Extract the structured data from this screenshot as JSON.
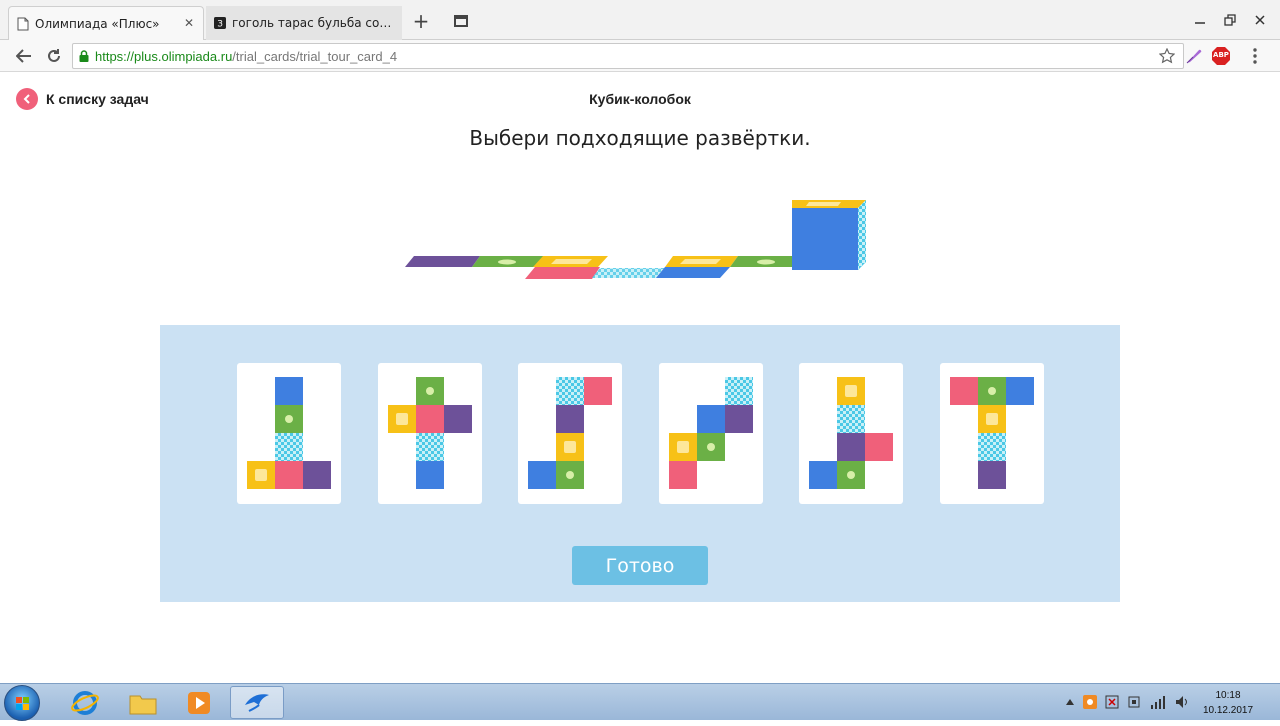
{
  "browser": {
    "tabs": [
      {
        "title": "Олимпиада «Плюс»",
        "active": true,
        "icon": "page-icon"
      },
      {
        "title": "гоголь тарас бульба сочинение",
        "active": false,
        "icon": "yandex-z-icon"
      }
    ],
    "new_tab_glyph": "+",
    "url_host": "https://plus.olimpiada.ru",
    "url_path": "/trial_cards/trial_tour_card_4",
    "extensions": [
      "star-icon",
      "feather-icon",
      "adblock-icon",
      "menu-icon"
    ],
    "adblock_label": "ABP"
  },
  "page": {
    "back_label": "К списку задач",
    "card_title": "Кубик-колобок",
    "prompt": "Выбери подходящие развёртки.",
    "done_label": "Готово"
  },
  "colors": {
    "blue": "#3f7fe0",
    "green": "#6bb046",
    "yellow": "#f7c117",
    "red": "#f0607a",
    "purple": "#6d5199",
    "checker": "#4bc8e6",
    "panel": "#cbe1f3",
    "button": "#6cc0e4"
  },
  "nets": [
    {
      "name": "option-1",
      "cells": [
        {
          "row": 0,
          "col": 1,
          "color": "blue"
        },
        {
          "row": 1,
          "col": 1,
          "color": "green"
        },
        {
          "row": 2,
          "col": 1,
          "color": "check"
        },
        {
          "row": 3,
          "col": 0,
          "color": "yellow"
        },
        {
          "row": 3,
          "col": 1,
          "color": "red"
        },
        {
          "row": 3,
          "col": 2,
          "color": "purple"
        }
      ]
    },
    {
      "name": "option-2",
      "cells": [
        {
          "row": 0,
          "col": 1,
          "color": "green"
        },
        {
          "row": 1,
          "col": 0,
          "color": "yellow"
        },
        {
          "row": 1,
          "col": 1,
          "color": "red"
        },
        {
          "row": 1,
          "col": 2,
          "color": "purple"
        },
        {
          "row": 2,
          "col": 1,
          "color": "check"
        },
        {
          "row": 3,
          "col": 1,
          "color": "blue"
        }
      ]
    },
    {
      "name": "option-3",
      "cells": [
        {
          "row": 0,
          "col": 1,
          "color": "check"
        },
        {
          "row": 0,
          "col": 2,
          "color": "red"
        },
        {
          "row": 1,
          "col": 1,
          "color": "purple"
        },
        {
          "row": 2,
          "col": 1,
          "color": "yellow"
        },
        {
          "row": 3,
          "col": 0,
          "color": "blue"
        },
        {
          "row": 3,
          "col": 1,
          "color": "green"
        }
      ]
    },
    {
      "name": "option-4",
      "cells": [
        {
          "row": 0,
          "col": 2,
          "color": "check"
        },
        {
          "row": 1,
          "col": 1,
          "color": "blue"
        },
        {
          "row": 1,
          "col": 2,
          "color": "purple"
        },
        {
          "row": 2,
          "col": 0,
          "color": "yellow"
        },
        {
          "row": 2,
          "col": 1,
          "color": "green"
        },
        {
          "row": 3,
          "col": 0,
          "color": "red"
        }
      ]
    },
    {
      "name": "option-5",
      "cells": [
        {
          "row": 0,
          "col": 1,
          "color": "yellow"
        },
        {
          "row": 1,
          "col": 1,
          "color": "check"
        },
        {
          "row": 2,
          "col": 1,
          "color": "purple"
        },
        {
          "row": 2,
          "col": 2,
          "color": "red"
        },
        {
          "row": 3,
          "col": 0,
          "color": "blue"
        },
        {
          "row": 3,
          "col": 1,
          "color": "green"
        }
      ]
    },
    {
      "name": "option-6",
      "cells": [
        {
          "row": 0,
          "col": 0,
          "color": "red"
        },
        {
          "row": 0,
          "col": 1,
          "color": "green"
        },
        {
          "row": 0,
          "col": 2,
          "color": "blue"
        },
        {
          "row": 1,
          "col": 1,
          "color": "yellow"
        },
        {
          "row": 2,
          "col": 1,
          "color": "check"
        },
        {
          "row": 3,
          "col": 1,
          "color": "purple"
        }
      ]
    }
  ],
  "taskbar": {
    "items": [
      "ie-icon",
      "explorer-icon",
      "media-player-icon",
      "app-bird-icon"
    ],
    "tray": [
      "tray-arrow-icon",
      "tray-app-icon",
      "tray-flag-icon",
      "tray-device-icon",
      "tray-network-icon",
      "tray-volume-icon"
    ],
    "time": "10:18",
    "date": "10.12.2017"
  }
}
